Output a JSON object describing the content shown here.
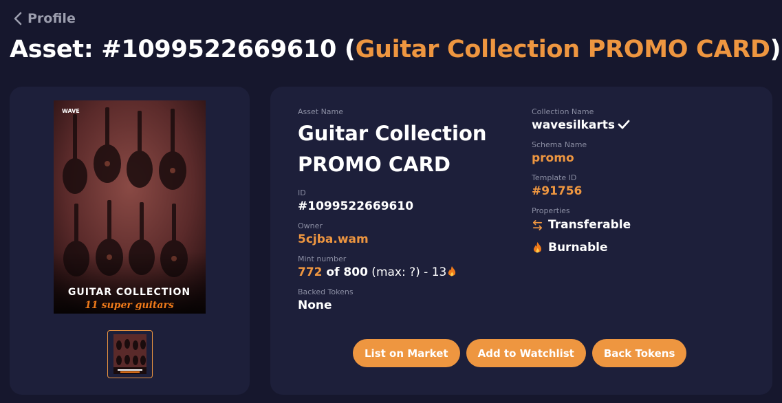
{
  "nav": {
    "back_label": "Profile"
  },
  "title": {
    "prefix": "Asset: #1099522669610 (",
    "accent": "Guitar Collection PROMO CARD",
    "suffix": ")"
  },
  "image": {
    "brand_text": "WAVE",
    "caption_line1": "GUITAR COLLECTION",
    "caption_line2": "11 super guitars"
  },
  "details": {
    "asset_name_label": "Asset Name",
    "asset_name_line1": "Guitar Collection",
    "asset_name_line2": "PROMO CARD",
    "id_label": "ID",
    "id_value": "#1099522669610",
    "owner_label": "Owner",
    "owner_value": "5cjba.wam",
    "mint_label": "Mint number",
    "mint_number": "772",
    "mint_of": " of 800",
    "mint_extra": " (max: ?) - 13",
    "backed_label": "Backed Tokens",
    "backed_value": "None",
    "collection_label": "Collection Name",
    "collection_value": "wavesilkarts",
    "schema_label": "Schema Name",
    "schema_value": "promo",
    "template_label": "Template ID",
    "template_value": "#91756",
    "properties_label": "Properties",
    "prop_transferable": "Transferable",
    "prop_burnable": "Burnable"
  },
  "actions": {
    "list_label": "List on Market",
    "watch_label": "Add to Watchlist",
    "back_tokens_label": "Back Tokens"
  },
  "colors": {
    "background": "#16172d",
    "panel": "#1d1f3a",
    "accent": "#ee9640",
    "muted": "#8b8ea3"
  },
  "icons": [
    "chevron-left-icon",
    "verified-check-icon",
    "transfer-arrows-icon",
    "fire-icon"
  ]
}
